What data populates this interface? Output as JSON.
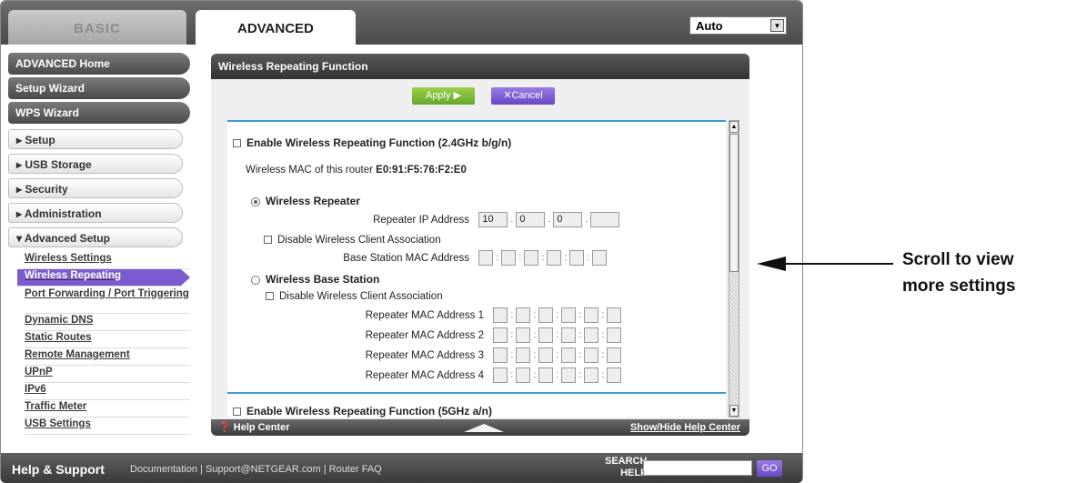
{
  "tabs": {
    "basic": "BASIC",
    "advanced": "ADVANCED"
  },
  "language": {
    "value": "Auto"
  },
  "sidebar": {
    "dark": [
      "ADVANCED Home",
      "Setup Wizard",
      "WPS Wizard"
    ],
    "light": [
      "▸ Setup",
      "▸ USB Storage",
      "▸ Security",
      "▸ Administration",
      "▾ Advanced Setup"
    ],
    "sub": [
      "Wireless Settings",
      "Wireless Repeating",
      "Port Forwarding / Port Triggering",
      "Dynamic DNS",
      "Static Routes",
      "Remote Management",
      "UPnP",
      "IPv6",
      "Traffic Meter",
      "USB Settings"
    ]
  },
  "panel": {
    "title": "Wireless Repeating Function",
    "apply": "Apply ▶",
    "cancel": "✕Cancel",
    "enable24": "Enable Wireless Repeating Function (2.4GHz b/g/n)",
    "mac_label": "Wireless MAC of this router",
    "mac_value": "E0:91:F5:76:F2:E0",
    "repeater": "Wireless Repeater",
    "repeater_ip_label": "Repeater IP Address",
    "ip": [
      "10",
      "0",
      "0",
      ""
    ],
    "disable_assoc": "Disable Wireless Client Association",
    "base_mac_label": "Base Station MAC Address",
    "base_station": "Wireless Base Station",
    "disable_assoc2": "Disable Wireless Client Association",
    "rep_mac": [
      "Repeater MAC Address 1",
      "Repeater MAC Address 2",
      "Repeater MAC Address 3",
      "Repeater MAC Address 4"
    ],
    "enable5": "Enable Wireless Repeating Function (5GHz a/n)"
  },
  "help_bar": {
    "left": "Help Center",
    "right": "Show/Hide Help Center"
  },
  "footer": {
    "help_support": "Help & Support",
    "links": "Documentation | Support@NETGEAR.com | Router FAQ",
    "search_label1": "SEARCH",
    "search_label2": "HELP",
    "go": "GO"
  },
  "annotation": {
    "line1": "Scroll to view",
    "line2": "more settings"
  }
}
